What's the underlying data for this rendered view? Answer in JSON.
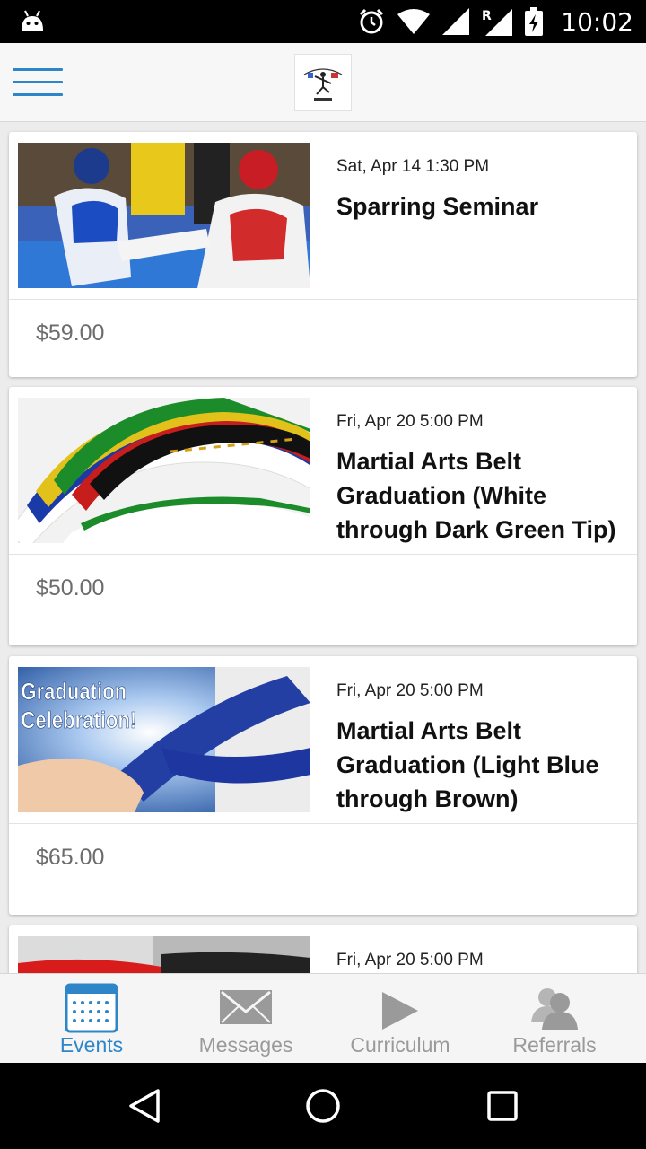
{
  "status_bar": {
    "time": "10:02",
    "icons": [
      "android-icon",
      "alarm-icon",
      "wifi-icon",
      "signal-icon",
      "roaming-signal-icon",
      "battery-charging-icon"
    ],
    "roaming_label": "R"
  },
  "app_bar": {
    "menu_icon": "hamburger-menu-icon",
    "logo_icon": "school-logo"
  },
  "events": [
    {
      "date": "Sat, Apr 14 1:30 PM",
      "title": "Sparring Seminar",
      "price": "$59.00",
      "image": "sparring-photo"
    },
    {
      "date": "Fri, Apr 20 5:00 PM",
      "title": "Martial Arts Belt Graduation (White through Dark Green Tip)",
      "price": "$50.00",
      "image": "belts-photo"
    },
    {
      "date": "Fri, Apr 20 5:00 PM",
      "title": "Martial Arts Belt Graduation (Light Blue through Brown)",
      "price": "$65.00",
      "image": "graduation-celebration-photo",
      "image_text": "Graduation Celebration!"
    },
    {
      "date": "Fri, Apr 20 5:00 PM",
      "title": "",
      "price": "",
      "image": "red-belt-photo"
    }
  ],
  "tabs": [
    {
      "label": "Events",
      "icon": "calendar-icon",
      "active": true
    },
    {
      "label": "Messages",
      "icon": "envelope-icon",
      "active": false
    },
    {
      "label": "Curriculum",
      "icon": "play-icon",
      "active": false
    },
    {
      "label": "Referrals",
      "icon": "people-icon",
      "active": false
    }
  ],
  "colors": {
    "accent": "#2e86c8",
    "inactive_tab": "#9a9a9a",
    "price": "#6c6c6c"
  },
  "nav_bar": {
    "icons": [
      "back-icon",
      "home-icon",
      "recents-icon"
    ]
  }
}
